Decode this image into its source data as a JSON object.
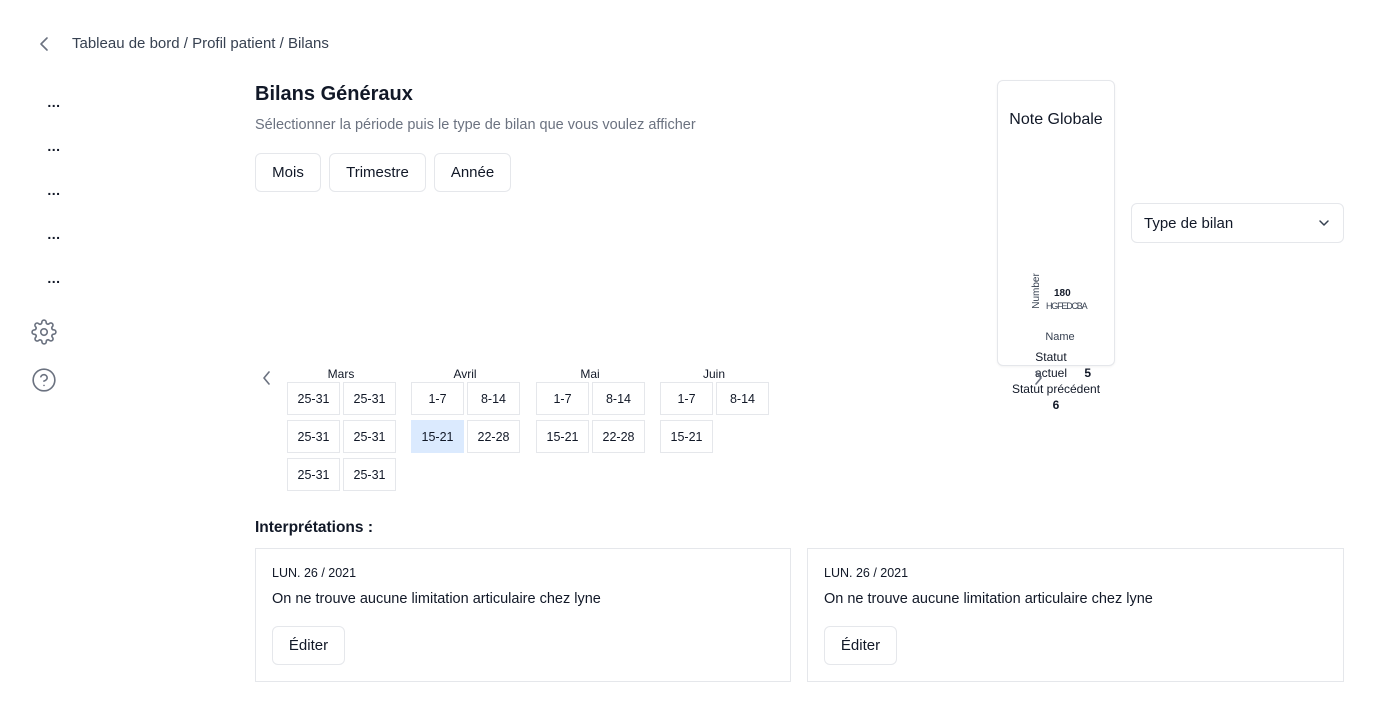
{
  "breadcrumb": "Tableau de bord / Profil patient / Bilans",
  "sidebar": {
    "items": [
      {
        "label": "..."
      },
      {
        "label": "..."
      },
      {
        "label": "..."
      },
      {
        "label": "..."
      },
      {
        "label": "..."
      }
    ],
    "icons": [
      "gear-icon",
      "help-circle-icon"
    ]
  },
  "header": {
    "title": "Bilans Généraux",
    "subtitle": "Sélectionner la période puis le type de bilan que vous voulez afficher"
  },
  "period_buttons": {
    "month": "Mois",
    "quarter": "Trimestre",
    "year": "Année"
  },
  "note_card": {
    "title": "Note Globale",
    "chart_overlap_text": {
      "axis_label": "Number",
      "tick_text": "180",
      "letters": "HGFEDCBA"
    },
    "legend_name": "Name",
    "current_label": "Statut actuel",
    "current_value": "5",
    "previous_label": "Statut précédent",
    "previous_value": "6"
  },
  "type_select": {
    "placeholder": "Type de bilan"
  },
  "calendar": {
    "months": [
      {
        "name": "Mars",
        "weeks": [
          "25-31",
          "25-31",
          "25-31",
          "25-31",
          "25-31",
          "25-31"
        ]
      },
      {
        "name": "Avril",
        "weeks": [
          "1-7",
          "8-14",
          "15-21",
          "22-28"
        ],
        "selected_index": 2
      },
      {
        "name": "Mai",
        "weeks": [
          "1-7",
          "8-14",
          "15-21",
          "22-28"
        ]
      },
      {
        "name": "Juin",
        "weeks": [
          "1-7",
          "8-14",
          "15-21"
        ]
      }
    ]
  },
  "interpretations": {
    "title": "Interprétations :",
    "cards": [
      {
        "date": "LUN. 26 / 2021",
        "text": "On ne trouve aucune limitation articulaire chez lyne",
        "edit_label": "Éditer"
      },
      {
        "date": "LUN. 26 / 2021",
        "text": "On ne trouve aucune limitation articulaire chez lyne",
        "edit_label": "Éditer"
      }
    ]
  },
  "colors": {
    "selected_week": "#dbeafe",
    "border": "#e5e7eb",
    "muted_text": "#6b7280"
  }
}
